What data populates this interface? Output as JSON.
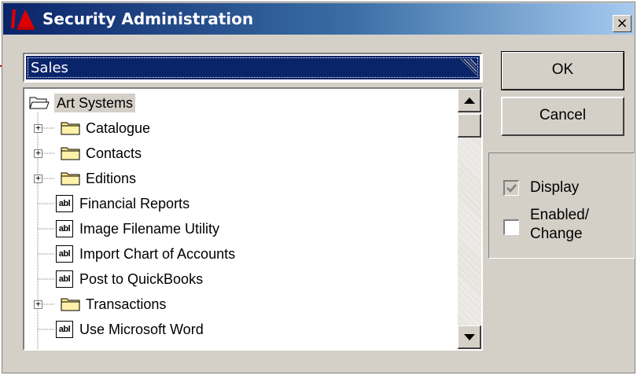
{
  "window": {
    "title": "Security Administration",
    "close_glyph": "×"
  },
  "selector": {
    "value": "Sales"
  },
  "tree": {
    "root": {
      "label": "Art Systems",
      "icon": "open-folder-icon"
    },
    "items": [
      {
        "label": "Catalogue",
        "type": "folder",
        "expander": "+"
      },
      {
        "label": "Contacts",
        "type": "folder",
        "expander": "+"
      },
      {
        "label": "Editions",
        "type": "folder",
        "expander": "+"
      },
      {
        "label": "Financial Reports",
        "type": "form",
        "icon_text": "abl"
      },
      {
        "label": "Image Filename Utility",
        "type": "form",
        "icon_text": "abl"
      },
      {
        "label": "Import Chart of Accounts",
        "type": "form",
        "icon_text": "abl"
      },
      {
        "label": "Post to QuickBooks",
        "type": "form",
        "icon_text": "abl"
      },
      {
        "label": "Transactions",
        "type": "folder",
        "expander": "+"
      },
      {
        "label": "Use Microsoft Word",
        "type": "form",
        "icon_text": "abl"
      }
    ]
  },
  "buttons": {
    "ok": "OK",
    "cancel": "Cancel"
  },
  "permissions": {
    "display_label": "Display",
    "display_checked": true,
    "enabled_label_line1": "Enabled/",
    "enabled_label_line2": "Change",
    "enabled_checked": false
  },
  "colors": {
    "selection": "#0a246a",
    "face": "#d4d0c8",
    "pointer_arrow": "#e00000"
  }
}
